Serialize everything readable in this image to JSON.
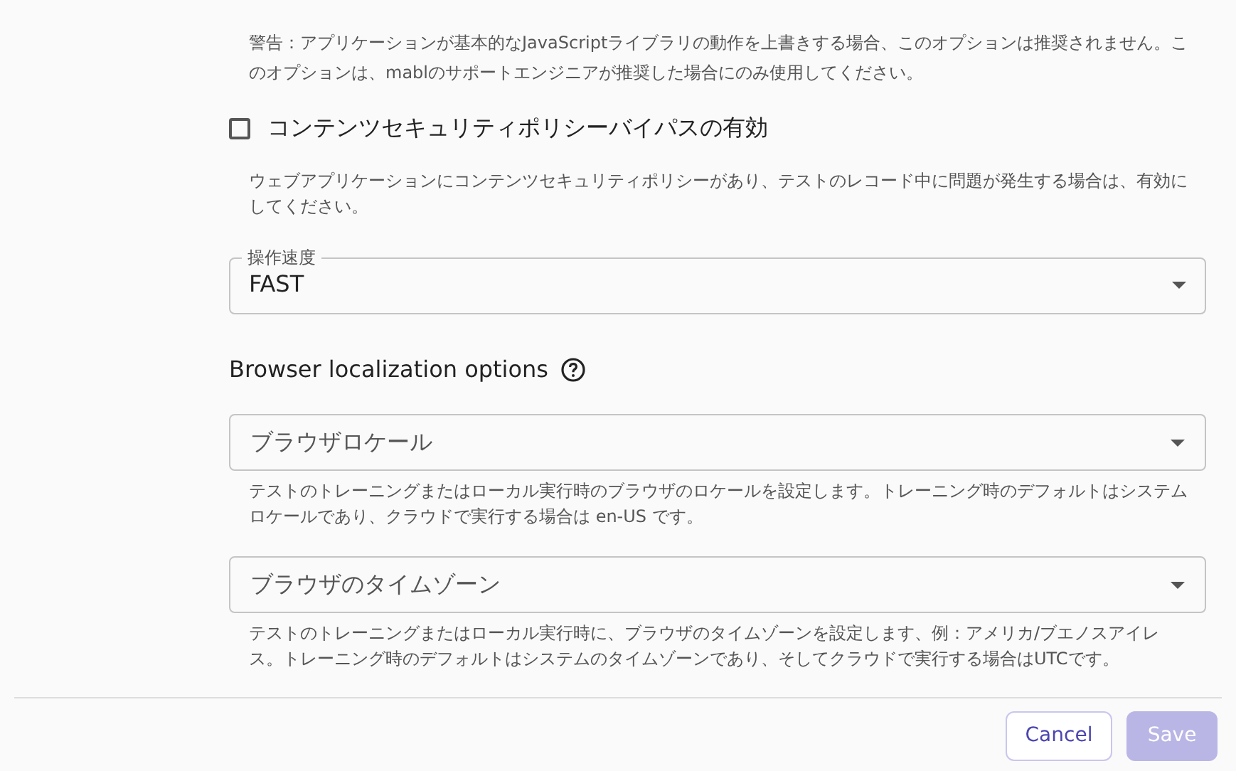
{
  "warning": "警告：アプリケーションが基本的なJavaScriptライブラリの動作を上書きする場合、このオプションは推奨されません。このオプションは、mablのサポートエンジニアが推奨した場合にのみ使用してください。",
  "checkbox": {
    "label": "コンテンツセキュリティポリシーバイパスの有効",
    "checked": false
  },
  "checkbox_help": "ウェブアプリケーションにコンテンツセキュリティポリシーがあり、テストのレコード中に問題が発生する場合は、有効にしてください。",
  "speed_select": {
    "label": "操作速度",
    "value": "FAST"
  },
  "localization": {
    "heading": "Browser localization options",
    "selects": [
      {
        "label": "ブラウザロケール",
        "help": "テストのトレーニングまたはローカル実行時のブラウザのロケールを設定します。トレーニング時のデフォルトはシステムロケールであり、クラウドで実行する場合は en-US です。"
      },
      {
        "label": "ブラウザのタイムゾーン",
        "help": "テストのトレーニングまたはローカル実行時に、ブラウザのタイムゾーンを設定します、例：アメリカ/ブエノスアイレス。トレーニング時のデフォルトはシステムのタイムゾーンであり、そしてクラウドで実行する場合はUTCです。"
      }
    ]
  },
  "buttons": [
    {
      "label": "Cancel",
      "kind": "outline",
      "disabled": false
    },
    {
      "label": "Save",
      "kind": "primary",
      "disabled": true
    }
  ]
}
